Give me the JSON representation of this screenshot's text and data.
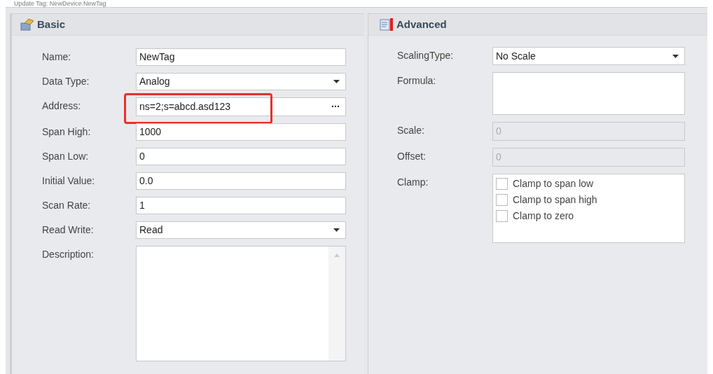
{
  "window": {
    "title": "Update Tag: NewDevice.NewTag"
  },
  "basic": {
    "title": "Basic",
    "fields": [
      {
        "label": "Name:",
        "kind": "text",
        "value": "NewTag",
        "highlighted": false
      },
      {
        "label": "Data Type:",
        "kind": "dropdown",
        "value": "Analog",
        "highlighted": false
      },
      {
        "label": "Address:",
        "kind": "browse",
        "value": "ns=2;s=abcd.asd123",
        "button": "···",
        "highlighted": true
      },
      {
        "label": "Span High:",
        "kind": "text",
        "value": "1000",
        "highlighted": false
      },
      {
        "label": "Span Low:",
        "kind": "text",
        "value": "0",
        "highlighted": false
      },
      {
        "label": "Initial Value:",
        "kind": "text",
        "value": "0.0",
        "highlighted": false
      },
      {
        "label": "Scan Rate:",
        "kind": "text",
        "value": "1",
        "highlighted": false
      },
      {
        "label": "Read Write:",
        "kind": "dropdown",
        "value": "Read",
        "highlighted": false
      },
      {
        "label": "Description:",
        "kind": "memo",
        "highlighted": false
      }
    ]
  },
  "advanced": {
    "title": "Advanced",
    "fields": [
      {
        "label": "ScalingType:",
        "kind": "dropdown",
        "value": "No Scale",
        "disabled": false
      },
      {
        "label": "Formula:",
        "kind": "area",
        "disabled": false
      },
      {
        "label": "Scale:",
        "kind": "text",
        "value": "0",
        "disabled": true
      },
      {
        "label": "Offset:",
        "kind": "text",
        "value": "0",
        "disabled": true
      },
      {
        "label": "Clamp:",
        "kind": "checklist",
        "disabled": false,
        "items": [
          {
            "label": "Clamp to span low",
            "checked": false
          },
          {
            "label": "Clamp to span high",
            "checked": false
          },
          {
            "label": "Clamp to zero",
            "checked": false
          }
        ]
      }
    ]
  }
}
